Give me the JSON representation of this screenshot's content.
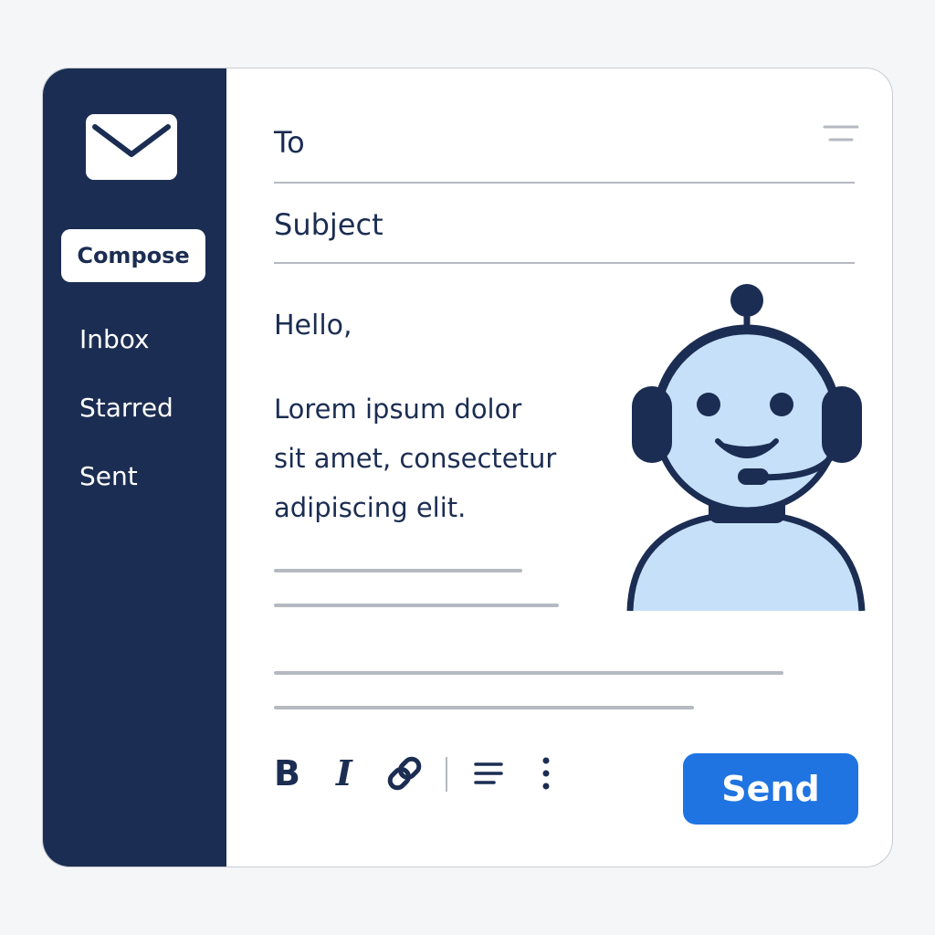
{
  "colors": {
    "sidebar_bg": "#1b2d52",
    "accent": "#1f74e1",
    "text": "#1b2d52",
    "divider": "#b5b9c0",
    "avatar_fill": "#c6e0fa"
  },
  "sidebar": {
    "logo_icon": "mail-envelope-icon",
    "compose_label": "Compose",
    "items": [
      {
        "label": "Inbox"
      },
      {
        "label": "Starred"
      },
      {
        "label": "Sent"
      }
    ]
  },
  "compose": {
    "to_label": "To",
    "subject_label": "Subject",
    "menu_icon": "menu-lines-icon",
    "greeting": "Hello,",
    "body_lines": [
      "Lorem ipsum dolor",
      "sit amet, consectetur",
      "adipiscing elit."
    ],
    "avatar_icon": "support-bot-avatar"
  },
  "toolbar": {
    "bold_label": "B",
    "italic_label": "I",
    "link_icon": "link-icon",
    "align_icon": "align-lines-icon",
    "more_icon": "more-vertical-icon",
    "send_label": "Send"
  }
}
